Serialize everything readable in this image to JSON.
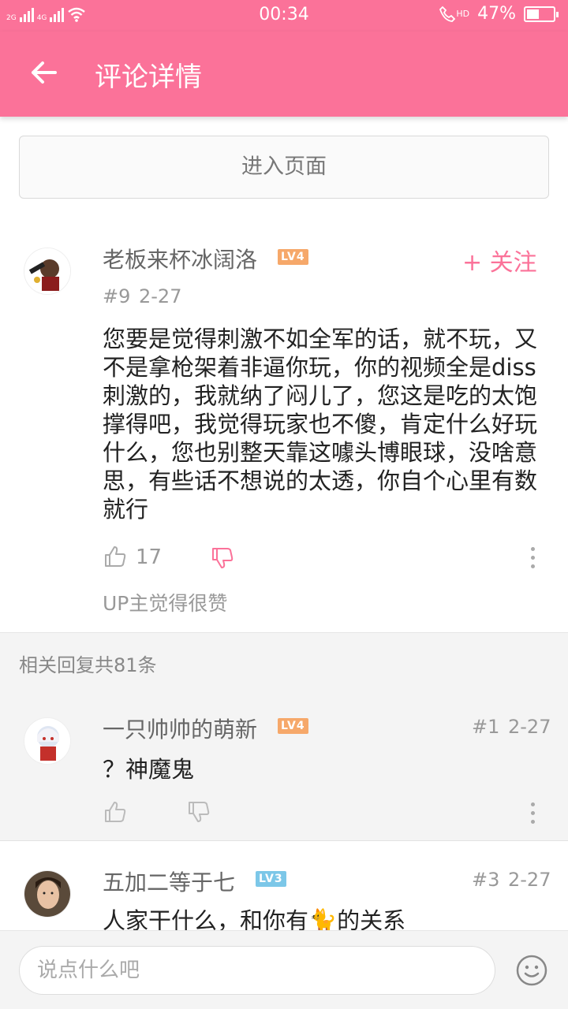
{
  "status_bar": {
    "network_1": "2G",
    "network_2": "4G",
    "time": "00:34",
    "hd_label": "HD",
    "battery_percent": "47%",
    "battery_level": 0.47
  },
  "app_bar": {
    "title": "评论详情"
  },
  "enter_page_label": "进入页面",
  "main_comment": {
    "username": "老板来杯冰阔洛",
    "level": "LV4",
    "follow_label": "+ 关注",
    "floor": "#9",
    "date": "2-27",
    "content": "您要是觉得刺激不如全军的话，就不玩，又不是拿枪架着非逼你玩，你的视频全是diss刺激的，我就纳了闷儿了，您这是吃的太饱撑得吧，我觉得玩家也不傻，肯定什么好玩什么，您也别整天靠这噱头博眼球，没啥意思，有些话不想说的太透，你自个心里有数就行",
    "like_count": "17",
    "up_note": "UP主觉得很赞"
  },
  "related_count_label": "相关回复共81条",
  "replies": [
    {
      "username": "一只帅帅的萌新",
      "level": "LV4",
      "floor": "#1",
      "date": "2-27",
      "content": "？神魔鬼"
    },
    {
      "username": "五加二等于七",
      "level": "LV3",
      "floor": "#3",
      "date": "2-27",
      "content": "人家干什么，和你有🐈的关系"
    }
  ],
  "bottom_bar": {
    "placeholder": "说点什么吧"
  },
  "colors": {
    "accent": "#fb7299",
    "lv4": "#f6a86a",
    "lv3": "#7cc7e8"
  },
  "icons": [
    "back-arrow-icon",
    "wifi-icon",
    "call-icon",
    "battery-icon",
    "thumbs-up-icon",
    "thumbs-down-icon",
    "more-vertical-icon",
    "emoji-icon"
  ]
}
